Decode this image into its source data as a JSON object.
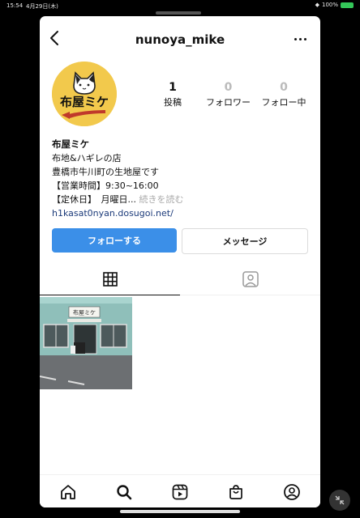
{
  "status": {
    "time": "15:54",
    "date": "4月29日(木)",
    "battery": "100%"
  },
  "header": {
    "username": "nunoya_mike"
  },
  "avatar": {
    "logo_text": "布屋ミケ"
  },
  "stats": [
    {
      "value": "1",
      "label": "投稿"
    },
    {
      "value": "0",
      "label": "フォロワー"
    },
    {
      "value": "0",
      "label": "フォロー中"
    }
  ],
  "bio": {
    "name": "布屋ミケ",
    "line1": "布地&ハギレの店",
    "line2": "豊橋市牛川町の生地屋です",
    "line3": "【営業時間】9:30~16:00",
    "line4": "【定休日】　月曜日...",
    "more": "続きを読む",
    "link": "h1kasat0nyan.dosugoi.net/"
  },
  "buttons": {
    "follow": "フォローする",
    "message": "メッセージ"
  },
  "post": {
    "sign_text": "布屋ミケ"
  },
  "icons": {
    "back": "chevron-left-icon",
    "more": "more-horizontal-icon",
    "grid": "grid-icon",
    "tagged": "tagged-person-icon",
    "home": "home-icon",
    "search": "search-icon",
    "reels": "reels-icon",
    "shop": "shopping-bag-icon",
    "profile": "profile-icon"
  },
  "colors": {
    "accent": "#3b8fe8",
    "link": "#1c3b7a",
    "avatar_bg": "#f2c94c"
  }
}
